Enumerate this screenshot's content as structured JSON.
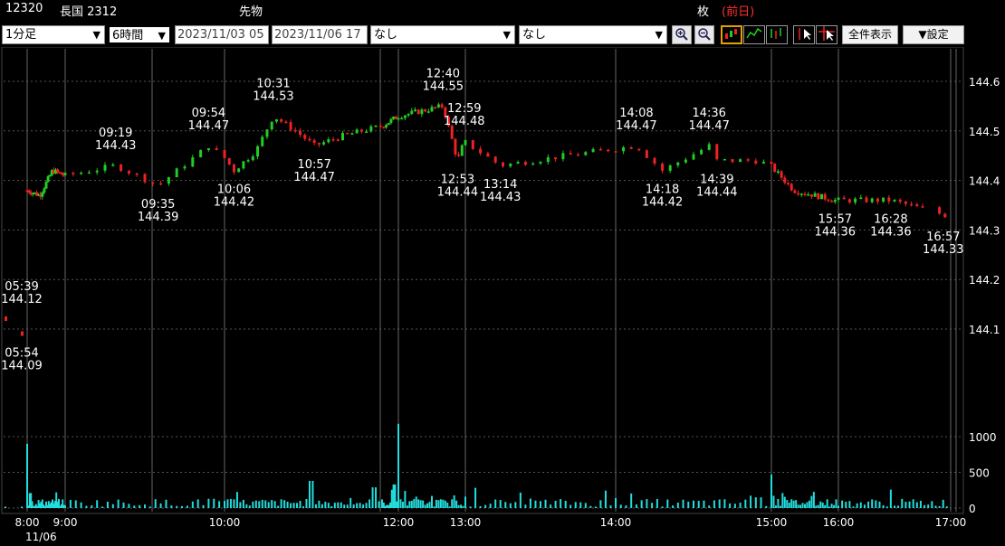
{
  "header": {
    "code": "12320",
    "name": "長国 2312",
    "market": "先物",
    "unit": "枚",
    "prev": "(前日)"
  },
  "toolbar": {
    "interval": "1分足",
    "span": "6時間",
    "from": "2023/11/03 05",
    "to": "2023/11/06 17",
    "indicator1": "なし",
    "indicator2": "なし",
    "zoom_in_icon": "zoom-in-icon",
    "zoom_out_icon": "zoom-out-icon",
    "show_all": "全件表示",
    "settings": "▼設定"
  },
  "colors": {
    "up": "#22cc22",
    "down": "#ee2222",
    "volume": "#22dddd",
    "grid": "#555555",
    "bg": "#000000"
  },
  "chart_data": {
    "type": "candlestick",
    "price_axis": {
      "ticks": [
        144.1,
        144.2,
        144.3,
        144.4,
        144.5,
        144.6
      ],
      "range": [
        144.05,
        144.67
      ]
    },
    "volume_axis": {
      "ticks": [
        0,
        500,
        1000
      ],
      "range": [
        0,
        1200
      ]
    },
    "time_axis": {
      "ticks": [
        {
          "t": "8:00",
          "label": "8:00"
        },
        {
          "t": "9:00",
          "label": "9:00"
        },
        {
          "t": "10:00",
          "label": "10:00"
        },
        {
          "t": "12:00",
          "label": "12:00"
        },
        {
          "t": "13:00",
          "label": "13:00"
        },
        {
          "t": "14:00",
          "label": "14:00"
        },
        {
          "t": "15:00",
          "label": "15:00"
        },
        {
          "t": "16:00",
          "label": "16:00"
        },
        {
          "t": "17:00",
          "label": "17:00"
        }
      ],
      "date_label": "11/06"
    },
    "price_path": [
      [
        "05:39",
        144.12
      ],
      [
        "05:54",
        144.09
      ],
      [
        "08:00",
        144.38
      ],
      [
        "08:20",
        144.37
      ],
      [
        "08:40",
        144.42
      ],
      [
        "09:00",
        144.41
      ],
      [
        "09:19",
        144.43
      ],
      [
        "09:35",
        144.39
      ],
      [
        "09:54",
        144.47
      ],
      [
        "10:06",
        144.42
      ],
      [
        "10:20",
        144.46
      ],
      [
        "10:31",
        144.53
      ],
      [
        "10:45",
        144.5
      ],
      [
        "10:57",
        144.47
      ],
      [
        "11:15",
        144.49
      ],
      [
        "11:40",
        144.51
      ],
      [
        "12:00",
        144.53
      ],
      [
        "12:40",
        144.55
      ],
      [
        "12:53",
        144.44
      ],
      [
        "12:59",
        144.48
      ],
      [
        "13:14",
        144.43
      ],
      [
        "13:40",
        144.45
      ],
      [
        "14:08",
        144.47
      ],
      [
        "14:18",
        144.42
      ],
      [
        "14:36",
        144.47
      ],
      [
        "14:39",
        144.44
      ],
      [
        "14:55",
        144.44
      ],
      [
        "15:20",
        144.38
      ],
      [
        "15:57",
        144.36
      ],
      [
        "16:28",
        144.36
      ],
      [
        "16:57",
        144.33
      ]
    ],
    "annotations": [
      {
        "time": "05:39",
        "price": 144.12,
        "label_time": "05:39",
        "label_price": "144.12"
      },
      {
        "time": "05:54",
        "price": 144.09,
        "label_time": "05:54",
        "label_price": "144.09"
      },
      {
        "time": "09:19",
        "price": 144.43,
        "label_time": "09:19",
        "label_price": "144.43"
      },
      {
        "time": "09:35",
        "price": 144.39,
        "label_time": "09:35",
        "label_price": "144.39"
      },
      {
        "time": "09:54",
        "price": 144.47,
        "label_time": "09:54",
        "label_price": "144.47"
      },
      {
        "time": "10:06",
        "price": 144.42,
        "label_time": "10:06",
        "label_price": "144.42"
      },
      {
        "time": "10:31",
        "price": 144.53,
        "label_time": "10:31",
        "label_price": "144.53"
      },
      {
        "time": "10:57",
        "price": 144.47,
        "label_time": "10:57",
        "label_price": "144.47"
      },
      {
        "time": "12:40",
        "price": 144.55,
        "label_time": "12:40",
        "label_price": "144.55"
      },
      {
        "time": "12:53",
        "price": 144.44,
        "label_time": "12:53",
        "label_price": "144.44"
      },
      {
        "time": "12:59",
        "price": 144.48,
        "label_time": "12:59",
        "label_price": "144.48"
      },
      {
        "time": "13:14",
        "price": 144.43,
        "label_time": "13:14",
        "label_price": "144.43"
      },
      {
        "time": "14:08",
        "price": 144.47,
        "label_time": "14:08",
        "label_price": "144.47"
      },
      {
        "time": "14:18",
        "price": 144.42,
        "label_time": "14:18",
        "label_price": "144.42"
      },
      {
        "time": "14:36",
        "price": 144.47,
        "label_time": "14:36",
        "label_price": "144.47"
      },
      {
        "time": "14:39",
        "price": 144.44,
        "label_time": "14:39",
        "label_price": "144.44"
      },
      {
        "time": "15:57",
        "price": 144.36,
        "label_time": "15:57",
        "label_price": "144.36"
      },
      {
        "time": "16:28",
        "price": 144.36,
        "label_time": "16:28",
        "label_price": "144.36"
      },
      {
        "time": "16:57",
        "price": 144.33,
        "label_time": "16:57",
        "label_price": "144.33"
      }
    ],
    "volume_spikes": [
      [
        "08:00",
        900
      ],
      [
        "08:05",
        210
      ],
      [
        "09:55",
        130
      ],
      [
        "10:55",
        380
      ],
      [
        "11:35",
        290
      ],
      [
        "11:55",
        330
      ],
      [
        "12:00",
        1180
      ],
      [
        "12:30",
        170
      ],
      [
        "13:00",
        160
      ],
      [
        "14:00",
        140
      ],
      [
        "14:55",
        150
      ],
      [
        "15:00",
        470
      ],
      [
        "15:10",
        210
      ]
    ]
  }
}
